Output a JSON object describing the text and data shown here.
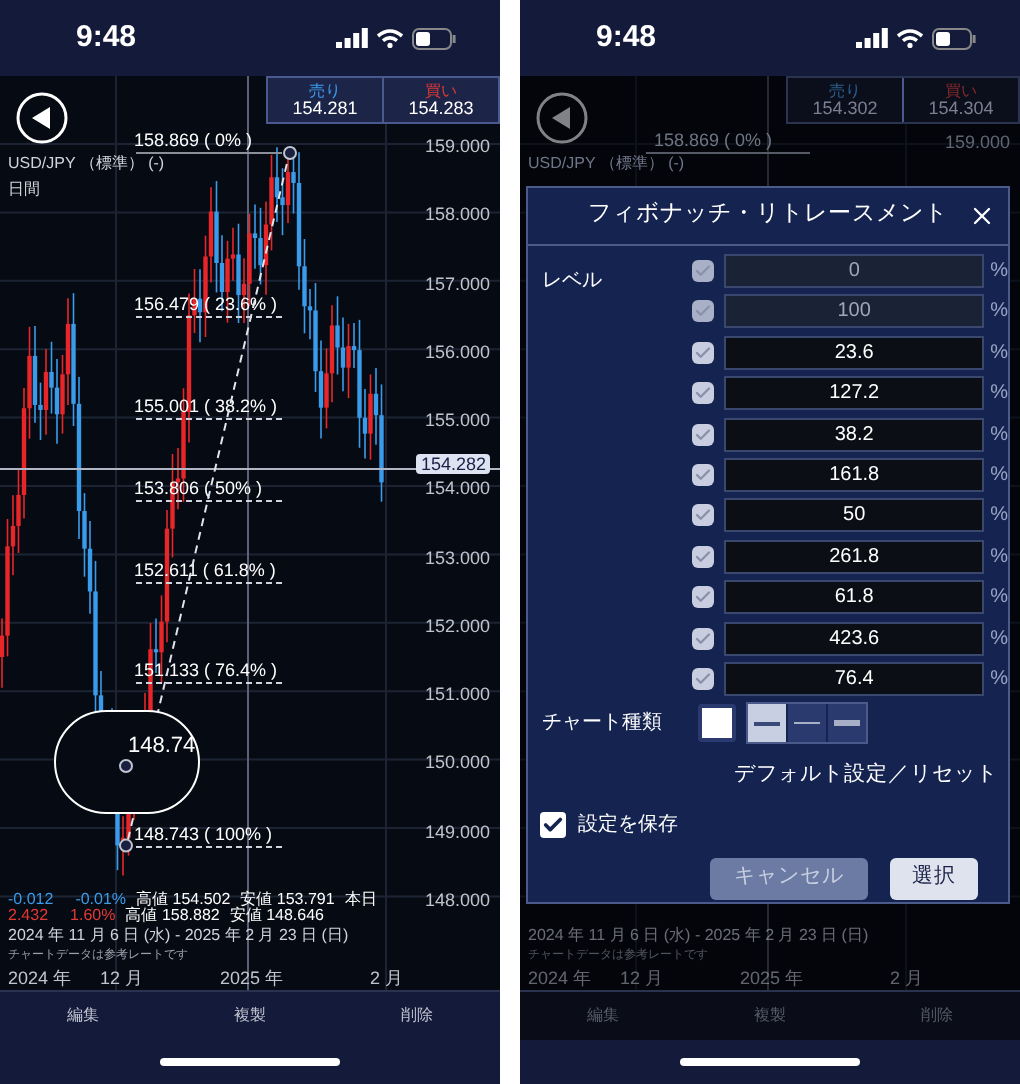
{
  "chart_screen": {
    "status_bar": {
      "time": "9:48"
    },
    "quote": {
      "sell_label": "売り",
      "sell_price": "154.281",
      "buy_label": "買い",
      "buy_price": "154.283"
    },
    "symbol": "USD/JPY （標準） (-)",
    "period": "日間",
    "price_axis": [
      "159.000",
      "158.000",
      "157.000",
      "156.000",
      "155.000",
      "154.000",
      "153.000",
      "152.000",
      "151.000",
      "150.000",
      "149.000",
      "148.000"
    ],
    "fib_labels": [
      "158.869 ( 0% )",
      "156.479 ( 23.6% )",
      "155.001 ( 38.2% )",
      "153.806 ( 50% )",
      "152.611 ( 61.8% )",
      "151.133 ( 76.4% )",
      "148.743 ( 100% )"
    ],
    "magnifier_price": "148.74",
    "current_price": "154.282",
    "stats": [
      [
        {
          "text": "-0.012",
          "color": "#3a9bea"
        },
        {
          "text": "-0.01%",
          "color": "#3a9bea"
        },
        {
          "text": "高値 154.502",
          "color": "#ffffff"
        },
        {
          "text": "安値 153.791",
          "color": "#ffffff"
        },
        {
          "text": "本日",
          "color": "#ffffff"
        }
      ],
      [
        {
          "text": "2.432",
          "color": "#e53935"
        },
        {
          "text": "1.60%",
          "color": "#e53935"
        },
        {
          "text": "高値 158.882",
          "color": "#ffffff"
        },
        {
          "text": "安値 148.646",
          "color": "#ffffff"
        }
      ]
    ],
    "date_range": "2024 年 11 月 6 日 (水) - 2025 年 2 月 23 日 (日)",
    "note": "チャートデータは参考レートです",
    "time_axis": [
      "2024 年",
      "12 月",
      "2025 年",
      "2 月"
    ],
    "toolbar": [
      "編集",
      "複製",
      "削除"
    ]
  },
  "dialog_screen": {
    "status_bar": {
      "time": "9:48"
    },
    "quote": {
      "sell_label": "売り",
      "sell_price": "154.302",
      "buy_label": "買い",
      "buy_price": "154.304"
    },
    "fib_label": "158.869 ( 0% )",
    "price_label": "159.000",
    "symbol": "USD/JPY （標準） (-)",
    "dialog": {
      "title": "フィボナッチ・リトレースメント",
      "level_label": "レベル",
      "levels": [
        {
          "value": "0",
          "unit": "%",
          "checked": true,
          "disabled": true
        },
        {
          "value": "100",
          "unit": "%",
          "checked": true,
          "disabled": true
        },
        {
          "value": "23.6",
          "unit": "%",
          "checked": true,
          "disabled": false
        },
        {
          "value": "127.2",
          "unit": "%",
          "checked": true,
          "disabled": false
        },
        {
          "value": "38.2",
          "unit": "%",
          "checked": true,
          "disabled": false
        },
        {
          "value": "161.8",
          "unit": "%",
          "checked": true,
          "disabled": false
        },
        {
          "value": "50",
          "unit": "%",
          "checked": true,
          "disabled": false
        },
        {
          "value": "261.8",
          "unit": "%",
          "checked": true,
          "disabled": false
        },
        {
          "value": "61.8",
          "unit": "%",
          "checked": true,
          "disabled": false
        },
        {
          "value": "423.6",
          "unit": "%",
          "checked": true,
          "disabled": false
        },
        {
          "value": "76.4",
          "unit": "%",
          "checked": true,
          "disabled": false
        }
      ],
      "chart_type_label": "チャート種類",
      "line_styles": [
        {
          "kind": "medium",
          "selected": true
        },
        {
          "kind": "thin",
          "selected": false
        },
        {
          "kind": "thick",
          "selected": false
        }
      ],
      "reset_link": "デフォルト設定／リセット",
      "save_settings": {
        "label": "設定を保存",
        "checked": true
      },
      "buttons": [
        {
          "label": "キャンセル",
          "kind": "secondary"
        },
        {
          "label": "選択",
          "kind": "primary"
        }
      ]
    },
    "date_range": "2024 年 11 月 6 日 (水) - 2025 年 2 月 23 日 (日)",
    "note": "チャートデータは参考レートです",
    "time_axis": [
      "2024 年",
      "12 月",
      "2025 年",
      "2 月"
    ],
    "toolbar": [
      "編集",
      "複製",
      "削除"
    ]
  }
}
